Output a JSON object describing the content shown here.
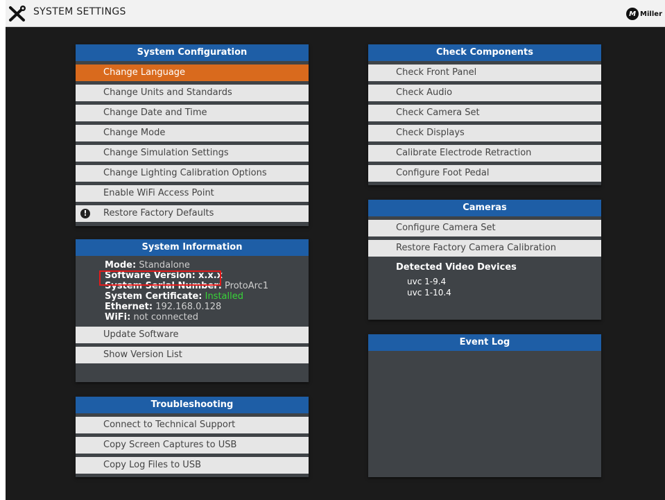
{
  "window": {
    "title": "SYSTEM SETTINGS",
    "brand": "Miller",
    "brand_mark": "M"
  },
  "system_configuration": {
    "header": "System Configuration",
    "items": [
      "Change Language",
      "Change Units and Standards",
      "Change Date and Time",
      "Change Mode",
      "Change Simulation Settings",
      "Change Lighting Calibration Options",
      "Enable WiFi Access Point",
      "Restore Factory Defaults"
    ]
  },
  "system_information": {
    "header": "System Information",
    "rows": [
      {
        "label": "Mode:",
        "value": "Standalone"
      },
      {
        "label": "Software Version:",
        "value": "x.x.x"
      },
      {
        "label": "System Serial Number:",
        "value": "ProtoArc1"
      },
      {
        "label": "System Certificate:",
        "value": "Installed"
      },
      {
        "label": "Ethernet:",
        "value": "192.168.0.128"
      },
      {
        "label": "WiFi:",
        "value": "not connected"
      }
    ],
    "items": [
      "Update Software",
      "Show Version List"
    ]
  },
  "troubleshooting": {
    "header": "Troubleshooting",
    "items": [
      "Connect to Technical Support",
      "Copy Screen Captures to USB",
      "Copy Log Files to USB"
    ]
  },
  "check_components": {
    "header": "Check Components",
    "items": [
      "Check Front Panel",
      "Check Audio",
      "Check Camera Set",
      "Check Displays",
      "Calibrate Electrode Retraction",
      "Configure Foot Pedal"
    ]
  },
  "cameras": {
    "header": "Cameras",
    "items": [
      "Configure Camera Set",
      "Restore Factory Camera Calibration"
    ],
    "devices_title": "Detected Video Devices",
    "devices": [
      "uvc 1-9.4",
      "uvc 1-10.4"
    ]
  },
  "event_log": {
    "header": "Event Log"
  },
  "colors": {
    "header_blue": "#1e5ea6",
    "active_orange": "#d96a1d",
    "installed_green": "#38d438",
    "highlight_red": "#e21b1b"
  }
}
